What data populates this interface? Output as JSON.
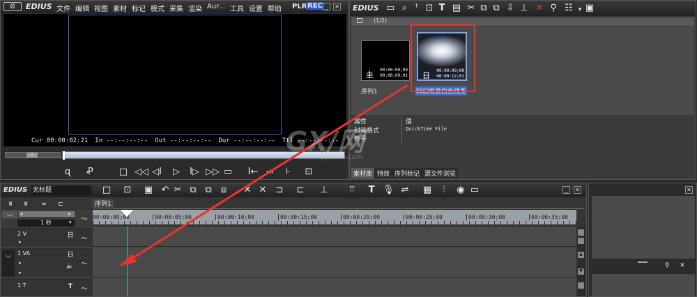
{
  "player": {
    "logo": "EDIUS",
    "menu": [
      "文件",
      "编辑",
      "视图",
      "素材",
      "标记",
      "模式",
      "采集",
      "渲染",
      "Aur...",
      "工具",
      "设置",
      "帮助"
    ],
    "plr": "PLR",
    "rec": "REC",
    "cur_label": "Cur",
    "cur": "00:00:02:21",
    "in_label": "In",
    "in": "--:--:--:--",
    "out_label": "Out",
    "out": "--:--:--:--",
    "dur_label": "Dur",
    "dur": "--:--:--:--",
    "ttl_label": "Ttl",
    "ttl": "--:--:--:--"
  },
  "bin": {
    "logo": "EDIUS",
    "folder_label": "(1/2)",
    "clips": [
      {
        "name": "序列1",
        "tc1": "00:00:00;00",
        "tc2": "00:00:00;01",
        "selected": false
      },
      {
        "name": "科幻唯美白色线条",
        "tc1": "00:00:00;00",
        "tc2": "00:00:12;01",
        "selected": true
      }
    ],
    "prop_header": "属性",
    "value_header": "值",
    "props": [
      {
        "k": "封装格式",
        "v": "QuickTime File"
      },
      {
        "k": "卷号",
        "v": ""
      }
    ],
    "tabs": [
      "素材库",
      "特效",
      "序列标记",
      "源文件浏览"
    ]
  },
  "timeline": {
    "logo": "EDIUS",
    "project": "无标题",
    "seq_tab": "序列1",
    "scale": "1 秒",
    "ruler": [
      "00:00:00;00",
      "00:00:05;00",
      "00:00:10;00",
      "00:00:15;00",
      "00:00:20;00",
      "00:00:25;00",
      "00:00:30;00",
      "00:00:35;00"
    ],
    "tracks": [
      "2 V",
      "1 VA",
      "1 T"
    ]
  },
  "watermark": {
    "text": "GX/网",
    "sub": "system.com"
  },
  "colors": {
    "accent_red": "#e8332f",
    "selection": "#3c6fc8",
    "rec_blue": "#2f55c9"
  }
}
